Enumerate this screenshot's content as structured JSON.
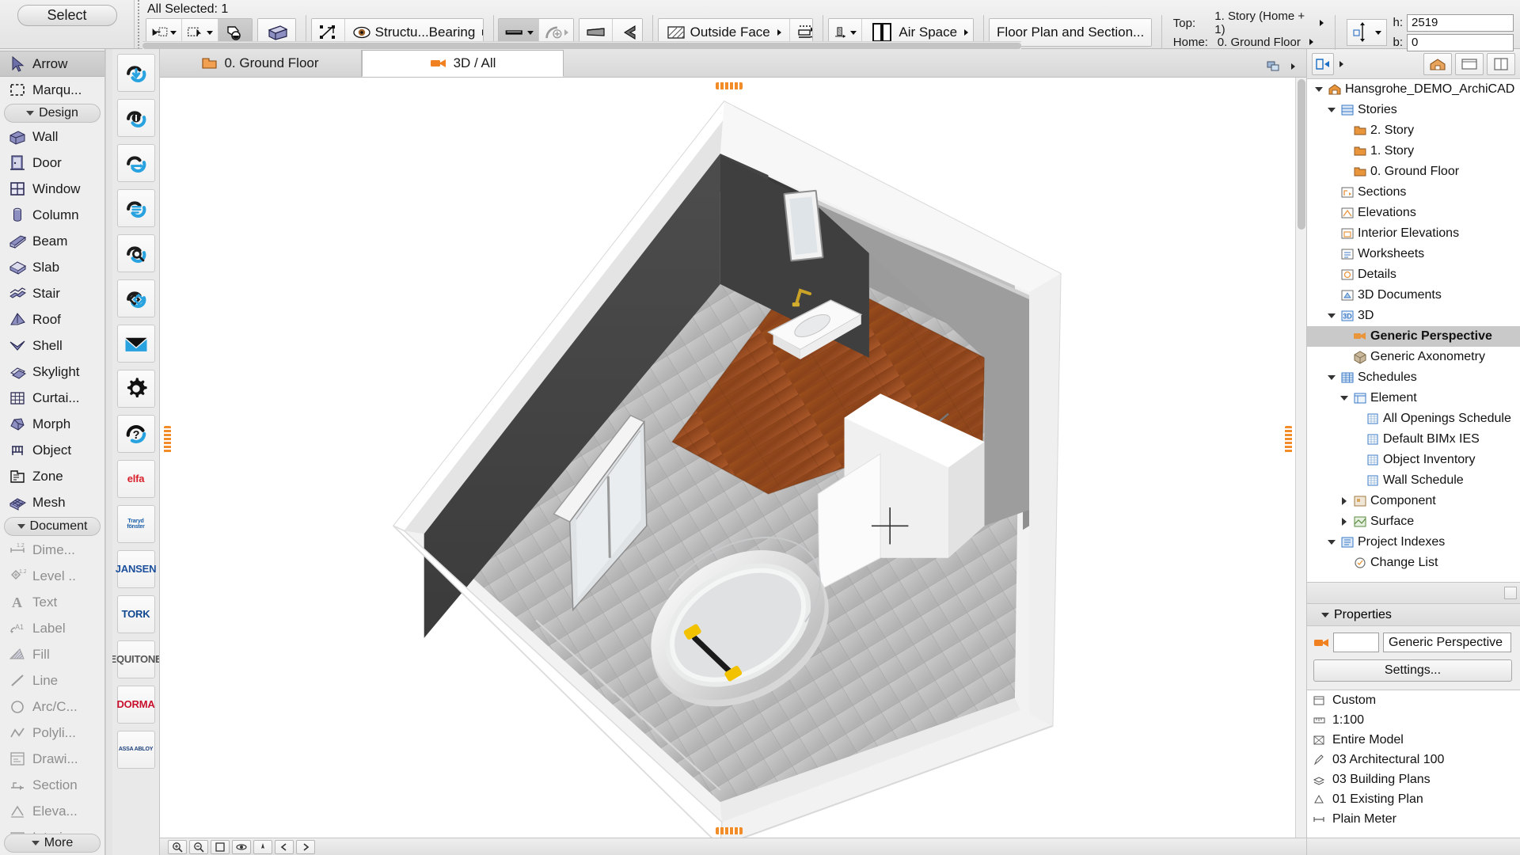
{
  "toolbar": {
    "selection_label": "All Selected: 1",
    "select_pill": "Select",
    "buttons": {
      "pointer_marquee": "pointer-select",
      "marquee": "marquee-select",
      "magic_wand": "magic-wand",
      "wall_tool": "wall-tool",
      "transform": "transform",
      "structure_label": "Structu...Bearing",
      "thickness": "wall-thickness",
      "curved": "curved-wall",
      "trapezoid": "trapezoid-wall",
      "polygon": "polygon-wall",
      "reference_label": "Outside Face",
      "flip": "flip-reference",
      "profile": "profile",
      "composite_label": "Air Space",
      "floor_plan_label": "Floor Plan and Section..."
    },
    "story": {
      "top_key": "Top:",
      "top_value": "1. Story (Home + 1)",
      "home_key": "Home:",
      "home_value": "0. Ground Floor"
    },
    "dimensions": {
      "h_label": "h:",
      "h_value": "2519",
      "b_label": "b:",
      "b_value": "0"
    }
  },
  "toolbox": {
    "sections": [
      {
        "label": "Design",
        "collapsed": false
      },
      {
        "label": "Document",
        "collapsed": false
      }
    ],
    "select_items": [
      {
        "label": "Arrow",
        "icon": "arrow-icon",
        "selected": true
      },
      {
        "label": "Marqu...",
        "icon": "marquee-icon",
        "selected": false
      }
    ],
    "design_items": [
      {
        "label": "Wall",
        "icon": "wall-icon"
      },
      {
        "label": "Door",
        "icon": "door-icon"
      },
      {
        "label": "Window",
        "icon": "window-icon"
      },
      {
        "label": "Column",
        "icon": "column-icon"
      },
      {
        "label": "Beam",
        "icon": "beam-icon"
      },
      {
        "label": "Slab",
        "icon": "slab-icon"
      },
      {
        "label": "Stair",
        "icon": "stair-icon"
      },
      {
        "label": "Roof",
        "icon": "roof-icon"
      },
      {
        "label": "Shell",
        "icon": "shell-icon"
      },
      {
        "label": "Skylight",
        "icon": "skylight-icon"
      },
      {
        "label": "Curtai...",
        "icon": "curtain-wall-icon"
      },
      {
        "label": "Morph",
        "icon": "morph-icon"
      },
      {
        "label": "Object",
        "icon": "object-icon"
      },
      {
        "label": "Zone",
        "icon": "zone-icon"
      },
      {
        "label": "Mesh",
        "icon": "mesh-icon"
      }
    ],
    "document_items": [
      {
        "label": "Dime...",
        "icon": "dimension-icon",
        "dim": true
      },
      {
        "label": "Level ..",
        "icon": "level-dimension-icon",
        "dim": true
      },
      {
        "label": "Text",
        "icon": "text-icon",
        "dim": true
      },
      {
        "label": "Label",
        "icon": "label-icon",
        "dim": true
      },
      {
        "label": "Fill",
        "icon": "fill-icon",
        "dim": true
      },
      {
        "label": "Line",
        "icon": "line-icon",
        "dim": true
      },
      {
        "label": "Arc/C...",
        "icon": "arc-circle-icon",
        "dim": true
      },
      {
        "label": "Polyli...",
        "icon": "polyline-icon",
        "dim": true
      },
      {
        "label": "Drawi...",
        "icon": "drawing-icon",
        "dim": true
      },
      {
        "label": "Section",
        "icon": "section-icon",
        "dim": true
      },
      {
        "label": "Eleva...",
        "icon": "elevation-icon",
        "dim": true
      },
      {
        "label": "Interi...",
        "icon": "interior-elevation-icon",
        "dim": true
      }
    ],
    "more_label": "More"
  },
  "palette": {
    "cloud_buttons": [
      {
        "name": "bimcloud-download-icon"
      },
      {
        "name": "bimcloud-info-icon"
      },
      {
        "name": "bimcloud-refresh-icon"
      },
      {
        "name": "bimcloud-list-icon"
      },
      {
        "name": "bimcloud-search-icon"
      },
      {
        "name": "bimcloud-link-icon"
      },
      {
        "name": "mail-icon"
      },
      {
        "name": "gear-icon"
      },
      {
        "name": "help-icon"
      }
    ],
    "logos": [
      {
        "name": "elfa-logo",
        "text": "elfa",
        "color": "#d8202a"
      },
      {
        "name": "traryd-fonster-logo",
        "text": "Traryd\nfönster",
        "color": "#1a5fa8"
      },
      {
        "name": "jansen-logo",
        "text": "JANSEN",
        "color": "#1b4f9c"
      },
      {
        "name": "tork-logo",
        "text": "TORK",
        "color": "#10488f"
      },
      {
        "name": "equitone-logo",
        "text": "EQUITONE",
        "color": "#555555"
      },
      {
        "name": "dorma-logo",
        "text": "DORMA",
        "color": "#c8102e"
      },
      {
        "name": "assa-abloy-logo",
        "text": "ASSA ABLOY",
        "color": "#1a3f7a"
      }
    ]
  },
  "tabs": [
    {
      "label": "0. Ground Floor",
      "icon": "floor-plan-icon",
      "active": false
    },
    {
      "label": "3D / All",
      "icon": "camera-3d-icon",
      "active": true
    }
  ],
  "navigator": {
    "toolbar_buttons": [
      {
        "name": "navigator-map-icon"
      },
      {
        "name": "project-tree-icon"
      },
      {
        "name": "view-map-icon"
      },
      {
        "name": "layout-book-icon"
      }
    ],
    "tree": [
      {
        "label": "Hansgrohe_DEMO_ArchiCAD",
        "depth": 0,
        "twist": "down",
        "icon": "project-icon",
        "selected": false
      },
      {
        "label": "Stories",
        "depth": 1,
        "twist": "down",
        "icon": "stories-icon",
        "selected": false
      },
      {
        "label": "2. Story",
        "depth": 2,
        "twist": "none",
        "icon": "story-icon",
        "selected": false
      },
      {
        "label": "1. Story",
        "depth": 2,
        "twist": "none",
        "icon": "story-icon",
        "selected": false
      },
      {
        "label": "0. Ground Floor",
        "depth": 2,
        "twist": "none",
        "icon": "story-icon",
        "selected": false
      },
      {
        "label": "Sections",
        "depth": 1,
        "twist": "none",
        "icon": "section-icon",
        "selected": false
      },
      {
        "label": "Elevations",
        "depth": 1,
        "twist": "none",
        "icon": "elevation-icon",
        "selected": false
      },
      {
        "label": "Interior Elevations",
        "depth": 1,
        "twist": "none",
        "icon": "interior-elevation-icon",
        "selected": false
      },
      {
        "label": "Worksheets",
        "depth": 1,
        "twist": "none",
        "icon": "worksheet-icon",
        "selected": false
      },
      {
        "label": "Details",
        "depth": 1,
        "twist": "none",
        "icon": "detail-icon",
        "selected": false
      },
      {
        "label": "3D Documents",
        "depth": 1,
        "twist": "none",
        "icon": "3d-document-icon",
        "selected": false
      },
      {
        "label": "3D",
        "depth": 1,
        "twist": "down",
        "icon": "3d-icon",
        "selected": false
      },
      {
        "label": "Generic Perspective",
        "depth": 2,
        "twist": "none",
        "icon": "perspective-icon",
        "selected": true
      },
      {
        "label": "Generic Axonometry",
        "depth": 2,
        "twist": "none",
        "icon": "axonometry-icon",
        "selected": false
      },
      {
        "label": "Schedules",
        "depth": 1,
        "twist": "down",
        "icon": "schedule-icon",
        "selected": false
      },
      {
        "label": "Element",
        "depth": 2,
        "twist": "down",
        "icon": "element-icon",
        "selected": false
      },
      {
        "label": "All Openings Schedule",
        "depth": 3,
        "twist": "none",
        "icon": "table-icon",
        "selected": false
      },
      {
        "label": "Default BIMx IES",
        "depth": 3,
        "twist": "none",
        "icon": "table-icon",
        "selected": false
      },
      {
        "label": "Object Inventory",
        "depth": 3,
        "twist": "none",
        "icon": "table-icon",
        "selected": false
      },
      {
        "label": "Wall Schedule",
        "depth": 3,
        "twist": "none",
        "icon": "table-icon",
        "selected": false
      },
      {
        "label": "Component",
        "depth": 2,
        "twist": "right",
        "icon": "component-icon",
        "selected": false
      },
      {
        "label": "Surface",
        "depth": 2,
        "twist": "right",
        "icon": "surface-icon",
        "selected": false
      },
      {
        "label": "Project Indexes",
        "depth": 1,
        "twist": "down",
        "icon": "index-icon",
        "selected": false
      },
      {
        "label": "Change List",
        "depth": 2,
        "twist": "none",
        "icon": "change-list-icon",
        "selected": false
      }
    ],
    "properties": {
      "header": "Properties",
      "name_value": "Generic Perspective",
      "settings_label": "Settings..."
    },
    "view_settings": [
      {
        "label": "Custom",
        "icon": "combination-icon"
      },
      {
        "label": "1:100",
        "icon": "scale-icon"
      },
      {
        "label": "Entire Model",
        "icon": "structure-icon"
      },
      {
        "label": "03 Architectural 100",
        "icon": "pen-set-icon"
      },
      {
        "label": "03 Building Plans",
        "icon": "layer-icon"
      },
      {
        "label": "01 Existing Plan",
        "icon": "renovation-icon"
      },
      {
        "label": "Plain Meter",
        "icon": "dimension-unit-icon"
      }
    ]
  }
}
